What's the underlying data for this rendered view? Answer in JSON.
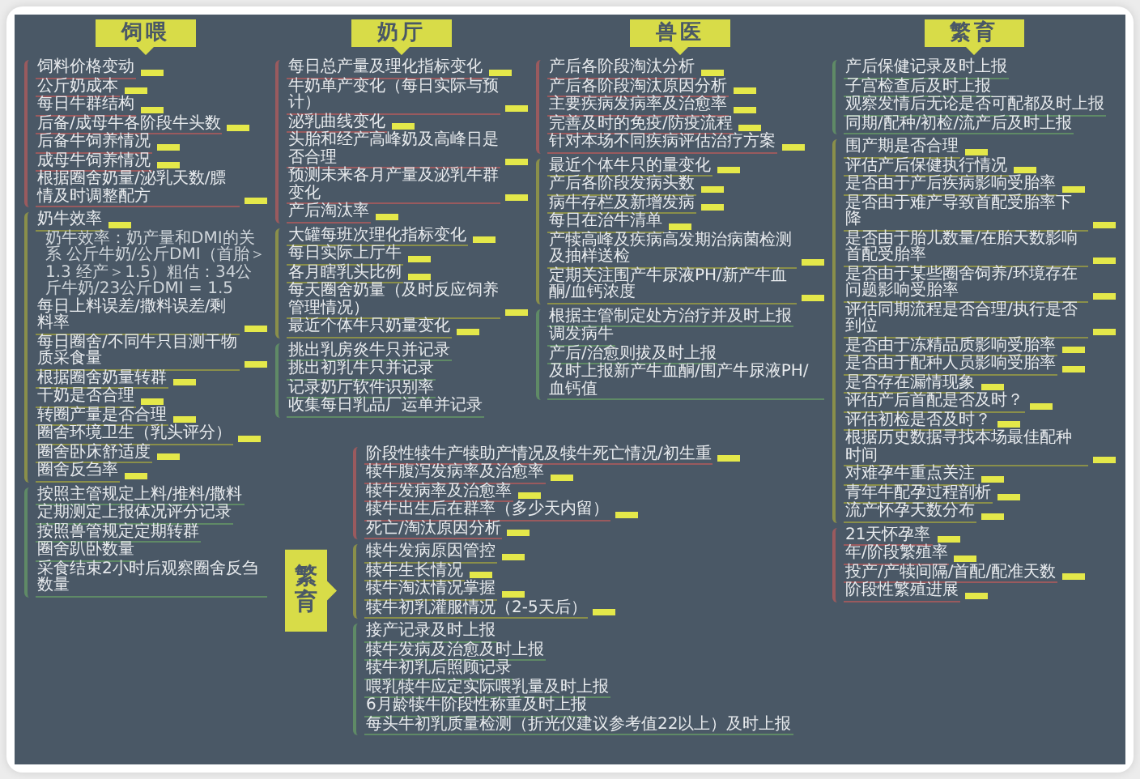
{
  "sections": [
    {
      "title": "饲喂",
      "kind": "top",
      "groups": [
        {
          "color": "#9a5a5e",
          "items": [
            {
              "text": "饲料价格变动",
              "note": true
            },
            {
              "text": "公斤奶成本",
              "note": true
            },
            {
              "text": "每日牛群结构",
              "note": true
            },
            {
              "text": "后备/成母牛各阶段牛头数",
              "note": true
            },
            {
              "text": "后备牛饲养情况",
              "note": true
            },
            {
              "text": "成母牛饲养情况",
              "note": true
            },
            {
              "text": "根据圈舍奶量/泌乳天数/膘情及时调整配方",
              "note": true
            }
          ]
        },
        {
          "color": "#8a8f4a",
          "items": [
            {
              "text": "奶牛效率",
              "note": true,
              "detail": "奶牛效率：奶产量和DMI的关系 公斤牛奶/公斤DMI（首胎＞1.3 经产＞1.5）粗估：34公斤牛奶/23公斤DMI = 1.5"
            },
            {
              "text": "每日上料误差/撒料误差/剩料率",
              "note": true
            },
            {
              "text": "每日圈舍/不同牛只目测干物质采食量",
              "note": true
            },
            {
              "text": "根据圈舍奶量转群",
              "note": true
            },
            {
              "text": "干奶是否合理",
              "note": true
            },
            {
              "text": "转圈产量是否合理",
              "note": true
            },
            {
              "text": "圈舍环境卫生（乳头评分）",
              "note": true
            },
            {
              "text": "圈舍卧床舒适度",
              "note": true
            },
            {
              "text": "圈舍反刍率",
              "note": true
            }
          ]
        },
        {
          "color": "#5f8a66",
          "items": [
            {
              "text": "按照主管规定上料/推料/撒料",
              "note": false
            },
            {
              "text": "定期测定上报体况评分记录",
              "note": false
            },
            {
              "text": "按照兽管规定定期转群",
              "note": false
            },
            {
              "text": "圈舍趴卧数量",
              "note": false
            },
            {
              "text": "采食结束2小时后观察圈舍反刍数量",
              "note": false
            }
          ]
        }
      ]
    },
    {
      "title": "奶厅",
      "kind": "top",
      "groups": [
        {
          "color": "#9a5a5e",
          "items": [
            {
              "text": "每日总产量及理化指标变化",
              "note": true
            },
            {
              "text": "牛奶单产变化（每日实际与预计）",
              "note": true
            },
            {
              "text": "泌乳曲线变化",
              "note": true
            },
            {
              "text": "头胎和经产高峰奶及高峰日是否合理",
              "note": true
            },
            {
              "text": "预测未来各月产量及泌乳牛群变化",
              "note": true
            },
            {
              "text": "产后淘汰率",
              "note": true
            }
          ]
        },
        {
          "color": "#8a8f4a",
          "items": [
            {
              "text": "大罐每班次理化指标变化",
              "note": true
            },
            {
              "text": "每日实际上厅牛",
              "note": true
            },
            {
              "text": "各月瞎乳头比例",
              "note": true
            },
            {
              "text": "每天圈舍奶量（及时反应饲养管理情况）",
              "note": true
            },
            {
              "text": "最近个体牛只奶量变化",
              "note": true
            }
          ]
        },
        {
          "color": "#5f8a66",
          "items": [
            {
              "text": "挑出乳房炎牛只并记录",
              "note": false
            },
            {
              "text": "挑出初乳牛只并记录",
              "note": false
            },
            {
              "text": "记录奶厅软件识别率",
              "note": false
            },
            {
              "text": "收集每日乳品厂运单并记录",
              "note": false
            }
          ]
        }
      ]
    },
    {
      "title": "兽医",
      "kind": "top",
      "groups": [
        {
          "color": "#9a5a5e",
          "items": [
            {
              "text": "产后各阶段淘汰分析",
              "note": true
            },
            {
              "text": "产后各阶段淘汰原因分析",
              "note": true
            },
            {
              "text": "主要疾病发病率及治愈率",
              "note": true
            },
            {
              "text": "完善及时的免疫/防疫流程",
              "note": true
            },
            {
              "text": "针对本场不同疾病评估治疗方案",
              "note": true
            }
          ]
        },
        {
          "color": "#8a8f4a",
          "items": [
            {
              "text": "最近个体牛只的量变化",
              "note": true
            },
            {
              "text": "产后各阶段发病头数",
              "note": true
            },
            {
              "text": "病牛存栏及新增发病",
              "note": true
            },
            {
              "text": "每日在治牛清单",
              "note": true
            },
            {
              "text": "产犊高峰及疾病高发期治病菌检测及抽样送检",
              "note": true
            },
            {
              "text": "定期关注围产牛尿液PH/新产牛血酮/血钙浓度",
              "note": true
            }
          ]
        },
        {
          "color": "#5f8a66",
          "items": [
            {
              "text": "根据主管制定处方治疗并及时上报",
              "note": false
            },
            {
              "text": "调发病牛",
              "note": false
            },
            {
              "text": "产后/治愈则拔及时上报",
              "note": false
            },
            {
              "text": "及时上报新产牛血酮/围产牛尿液PH/血钙值",
              "note": false
            }
          ]
        }
      ]
    },
    {
      "title": "繁育",
      "kind": "top",
      "groups": [
        {
          "color": "#5f8a66",
          "items": [
            {
              "text": "产后保健记录及时上报",
              "note": false
            },
            {
              "text": "子宫检查后及时上报",
              "note": false
            },
            {
              "text": "观察发情后无论是否可配都及时上报",
              "note": false
            },
            {
              "text": "同期/配种/初检/流产后及时上报",
              "note": false
            }
          ]
        },
        {
          "color": "#8a8f4a",
          "items": [
            {
              "text": "围产期是否合理",
              "note": true
            },
            {
              "text": "评估产后保健执行情况",
              "note": true
            },
            {
              "text": "是否由于产后疾病影响受胎率",
              "note": true
            },
            {
              "text": "是否由于难产导致首配受胎率下降",
              "note": true
            },
            {
              "text": "是否由于胎儿数量/在胎天数影响首配受胎率",
              "note": true
            },
            {
              "text": "是否由于某些圈舍饲养/环境存在问题影响受胎率",
              "note": true
            },
            {
              "text": "评估同期流程是否合理/执行是否到位",
              "note": true
            },
            {
              "text": "是否由于冻精品质影响受胎率",
              "note": true
            },
            {
              "text": "是否由于配种人员影响受胎率",
              "note": true
            },
            {
              "text": "是否存在漏情现象",
              "note": true
            },
            {
              "text": "评估产后首配是否及时？",
              "note": true
            },
            {
              "text": "评估初检是否及时？",
              "note": true
            },
            {
              "text": "根据历史数据寻找本场最佳配种时间",
              "note": true
            },
            {
              "text": "对难孕牛重点关注",
              "note": true
            },
            {
              "text": "青年牛配孕过程剖析",
              "note": true
            },
            {
              "text": "流产怀孕天数分布",
              "note": true
            }
          ]
        },
        {
          "color": "#9a5a5e",
          "items": [
            {
              "text": "21天怀孕率",
              "note": true
            },
            {
              "text": "年/阶段繁殖率",
              "note": true
            },
            {
              "text": "投产/产犊间隔/首配/配准天数",
              "note": true
            },
            {
              "text": "阶段性繁殖进展",
              "note": true
            }
          ]
        }
      ]
    },
    {
      "title": "繁育",
      "kind": "side",
      "groups": [
        {
          "color": "#9a5a5e",
          "items": [
            {
              "text": "阶段性犊牛产犊助产情况及犊牛死亡情况/初生重",
              "note": true
            },
            {
              "text": "犊牛腹泻发病率及治愈率",
              "note": true
            },
            {
              "text": "犊牛发病率及治愈率",
              "note": true
            },
            {
              "text": "犊牛出生后在群率（多少天内留）",
              "note": true
            },
            {
              "text": "死亡/淘汰原因分析",
              "note": true
            }
          ]
        },
        {
          "color": "#8a8f4a",
          "items": [
            {
              "text": "犊牛发病原因管控",
              "note": true
            },
            {
              "text": "犊牛生长情况",
              "note": true
            },
            {
              "text": "犊牛淘汰情况掌握",
              "note": true
            },
            {
              "text": "犊牛初乳灌服情况（2-5天后）",
              "note": true
            }
          ]
        },
        {
          "color": "#5f8a66",
          "items": [
            {
              "text": "接产记录及时上报",
              "note": false
            },
            {
              "text": "犊牛发病及治愈及时上报",
              "note": false
            },
            {
              "text": "犊牛初乳后照顾记录",
              "note": false
            },
            {
              "text": "喂乳犊牛应定实际喂乳量及时上报",
              "note": false
            },
            {
              "text": "6月龄犊牛阶段性称重及时上报",
              "note": false
            },
            {
              "text": "每头牛初乳质量检测（折光仪建议参考值22以上）及时上报",
              "note": false
            }
          ]
        }
      ]
    }
  ]
}
